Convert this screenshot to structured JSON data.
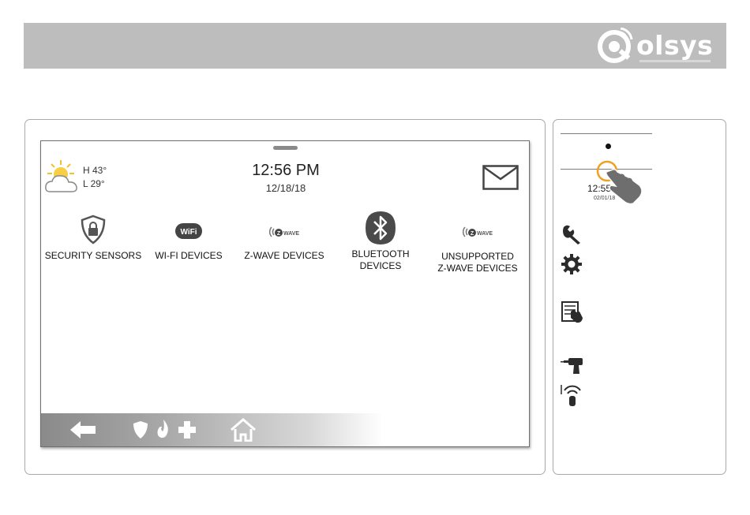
{
  "header": {
    "logo_text": "olsys",
    "brand_color": "#bdbdbd"
  },
  "screen": {
    "weather": {
      "icon": "partly-cloudy-icon",
      "high": "H 43°",
      "low": "L 29°"
    },
    "clock": {
      "time": "12:56 PM",
      "date": "12/18/18"
    },
    "messages_icon": "envelope-icon",
    "tiles": [
      {
        "icon": "security-shield-lock-icon",
        "label": "SECURITY SENSORS"
      },
      {
        "icon": "wifi-badge-icon",
        "label": "WI-FI DEVICES",
        "badge": "WiFi"
      },
      {
        "icon": "zwave-logo-icon",
        "label": "Z-WAVE DEVICES",
        "badge": "WAVE"
      },
      {
        "icon": "bluetooth-icon",
        "label": "BLUETOOTH\nDEVICES"
      },
      {
        "icon": "zwave-logo-icon",
        "label": "UNSUPPORTED\nZ-WAVE DEVICES",
        "badge": "WAVE"
      }
    ],
    "nav": [
      {
        "icon": "back-arrow-icon"
      },
      {
        "icon": "police-shield-icon"
      },
      {
        "icon": "fire-icon"
      },
      {
        "icon": "medical-cross-icon"
      },
      {
        "icon": "home-icon"
      }
    ]
  },
  "side_panel": {
    "mini_time": "12:55",
    "mini_date": "02/01/18",
    "icons": [
      "wrench-icon",
      "gear-icon",
      "touch-panel-icon",
      "drill-icon",
      "wireless-remote-icon"
    ]
  }
}
